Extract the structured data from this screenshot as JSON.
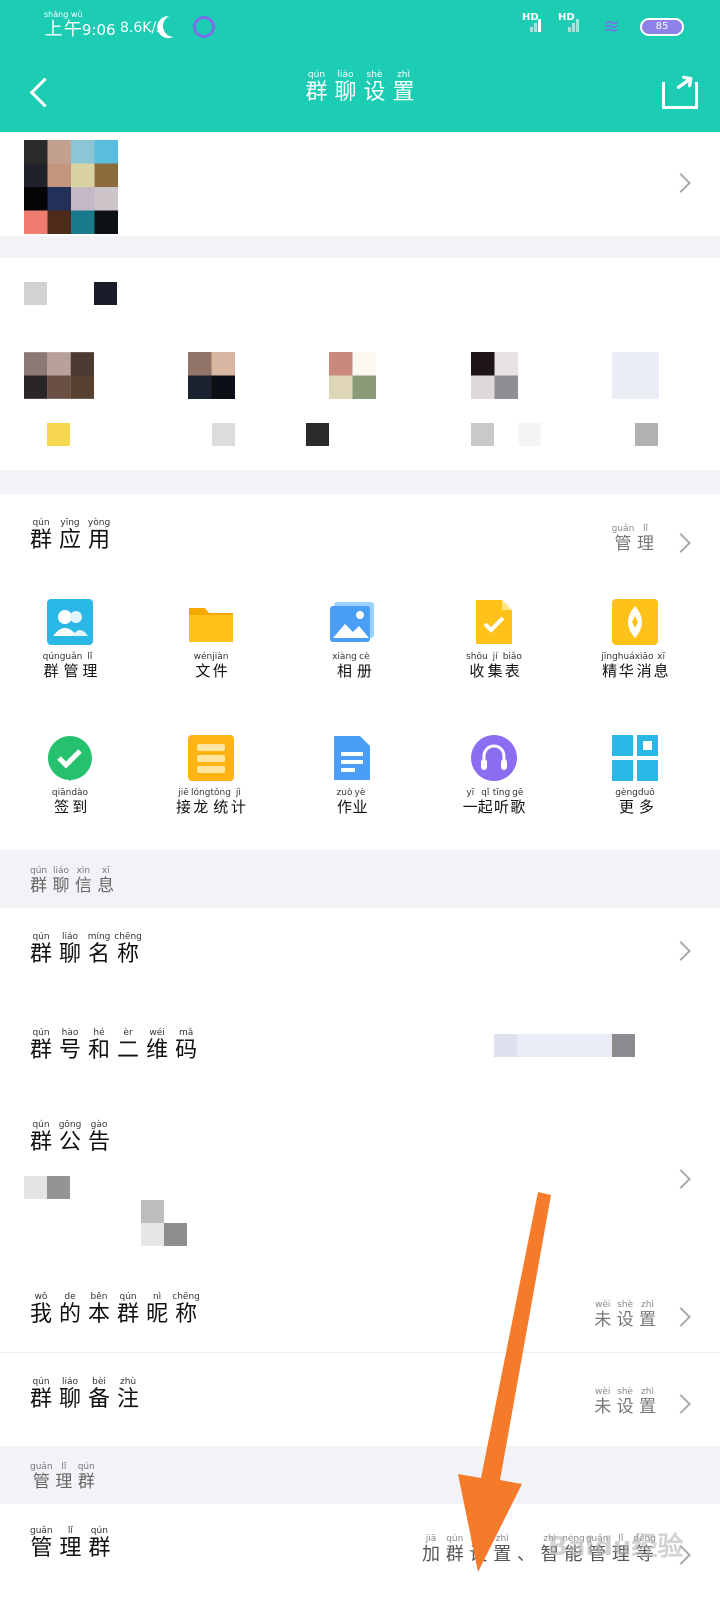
{
  "status_bar": {
    "time_prefix": "上午",
    "time_prefix_pinyin": "shàng wǔ",
    "time": "9:06",
    "speed": "8.6K/s",
    "hd1": "HD",
    "hd2": "HD",
    "battery": "85",
    "icons": [
      "moon-icon",
      "alarm-icon",
      "signal-icon",
      "wifi-icon",
      "battery-icon"
    ]
  },
  "navbar": {
    "title_chars": [
      {
        "c": "群",
        "p": "qún"
      },
      {
        "c": "聊",
        "p": "liáo"
      },
      {
        "c": "设",
        "p": "shè"
      },
      {
        "c": "置",
        "p": "zhì"
      }
    ],
    "icons": [
      "back-icon",
      "share-icon"
    ]
  },
  "group_apps": {
    "title_chars": [
      {
        "c": "群",
        "p": "qún"
      },
      {
        "c": "应",
        "p": "yīng"
      },
      {
        "c": "用",
        "p": "yòng"
      }
    ],
    "manage_chars": [
      {
        "c": "管",
        "p": "guǎn"
      },
      {
        "c": "理",
        "p": "lǐ"
      }
    ],
    "apps": [
      {
        "label": "群管理",
        "pinyin": [
          "qún",
          "guǎn",
          "lǐ"
        ],
        "icon": "group-manage-icon",
        "color": "#2ab7e6"
      },
      {
        "label": "文件",
        "pinyin": [
          "wén",
          "jiàn"
        ],
        "icon": "folder-icon",
        "color": "#ffc21a"
      },
      {
        "label": "相册",
        "pinyin": [
          "xiàng",
          "cè"
        ],
        "icon": "album-icon",
        "color": "#4a9ef5"
      },
      {
        "label": "收集表",
        "pinyin": [
          "shōu",
          "jí",
          "biǎo"
        ],
        "icon": "form-icon",
        "color": "#ffc21a"
      },
      {
        "label": "精华消息",
        "pinyin": [
          "jīng",
          "huá",
          "xiāo",
          "xī"
        ],
        "icon": "essence-icon",
        "color": "#ffc21a"
      },
      {
        "label": "签到",
        "pinyin": [
          "qiān",
          "dào"
        ],
        "icon": "checkin-icon",
        "color": "#25c16f"
      },
      {
        "label": "接龙统计",
        "pinyin": [
          "jiē",
          "lóng",
          "tǒng",
          "jì"
        ],
        "icon": "solitaire-icon",
        "color": "#ffb414"
      },
      {
        "label": "作业",
        "pinyin": [
          "zuò",
          "yè"
        ],
        "icon": "homework-icon",
        "color": "#4a9ef5"
      },
      {
        "label": "一起听歌",
        "pinyin": [
          "yī",
          "qǐ",
          "tīng",
          "gē"
        ],
        "icon": "music-icon",
        "color": "#8a6df0"
      },
      {
        "label": "更多",
        "pinyin": [
          "gèng",
          "duō"
        ],
        "icon": "more-grid-icon",
        "color": "#2ab7e6"
      }
    ]
  },
  "group_info": {
    "section_chars": [
      {
        "c": "群",
        "p": "qún"
      },
      {
        "c": "聊",
        "p": "liáo"
      },
      {
        "c": "信",
        "p": "xìn"
      },
      {
        "c": "息",
        "p": "xī"
      }
    ],
    "rows": [
      {
        "title": [
          {
            "c": "群",
            "p": "qún"
          },
          {
            "c": "聊",
            "p": "liáo"
          },
          {
            "c": "名",
            "p": "míng"
          },
          {
            "c": "称",
            "p": "chēng"
          }
        ],
        "value": []
      },
      {
        "title": [
          {
            "c": "群",
            "p": "qún"
          },
          {
            "c": "号",
            "p": "hào"
          },
          {
            "c": "和",
            "p": "hé"
          },
          {
            "c": "二",
            "p": "èr"
          },
          {
            "c": "维",
            "p": "wéi"
          },
          {
            "c": "码",
            "p": "mǎ"
          }
        ],
        "value": []
      },
      {
        "title": [
          {
            "c": "群",
            "p": "qún"
          },
          {
            "c": "公",
            "p": "gōng"
          },
          {
            "c": "告",
            "p": "gào"
          }
        ],
        "value": []
      },
      {
        "title": [
          {
            "c": "我",
            "p": "wǒ"
          },
          {
            "c": "的",
            "p": "de"
          },
          {
            "c": "本",
            "p": "běn"
          },
          {
            "c": "群",
            "p": "qún"
          },
          {
            "c": "昵",
            "p": "nì"
          },
          {
            "c": "称",
            "p": "chēng"
          }
        ],
        "value": [
          {
            "c": "未",
            "p": "wèi"
          },
          {
            "c": "设",
            "p": "shè"
          },
          {
            "c": "置",
            "p": "zhì"
          }
        ]
      },
      {
        "title": [
          {
            "c": "群",
            "p": "qún"
          },
          {
            "c": "聊",
            "p": "liáo"
          },
          {
            "c": "备",
            "p": "bèi"
          },
          {
            "c": "注",
            "p": "zhù"
          }
        ],
        "value": [
          {
            "c": "未",
            "p": "wèi"
          },
          {
            "c": "设",
            "p": "shè"
          },
          {
            "c": "置",
            "p": "zhì"
          }
        ]
      }
    ]
  },
  "manage_group": {
    "section_chars": [
      {
        "c": "管",
        "p": "guǎn"
      },
      {
        "c": "理",
        "p": "lǐ"
      },
      {
        "c": "群",
        "p": "qún"
      }
    ],
    "row_title": [
      {
        "c": "管",
        "p": "guǎn"
      },
      {
        "c": "理",
        "p": "lǐ"
      },
      {
        "c": "群",
        "p": "qún"
      }
    ],
    "row_value": [
      {
        "c": "加",
        "p": "jiā"
      },
      {
        "c": "群",
        "p": "qún"
      },
      {
        "c": "设",
        "p": "shè"
      },
      {
        "c": "置",
        "p": "zhì"
      },
      {
        "c": "、",
        "p": ""
      },
      {
        "c": "智",
        "p": "zhì"
      },
      {
        "c": "能",
        "p": "néng"
      },
      {
        "c": "管",
        "p": "guǎn"
      },
      {
        "c": "理",
        "p": "lǐ"
      },
      {
        "c": "等",
        "p": "děng"
      }
    ]
  },
  "watermark": "Baidu经验",
  "colors": {
    "accent": "#1ccdb4",
    "arrow": "#f57a2a",
    "background": "#f2f3f7"
  }
}
